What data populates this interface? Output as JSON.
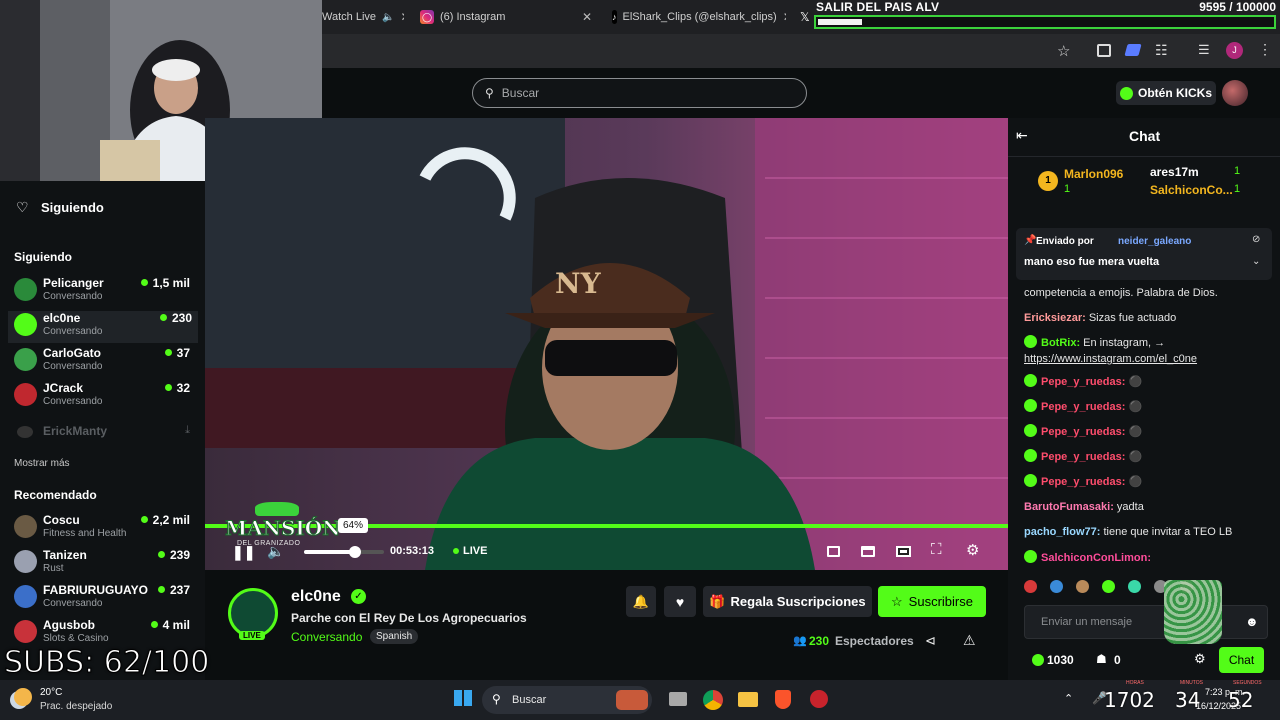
{
  "browser": {
    "tabs": [
      {
        "label": "Watch Live",
        "icon": "kick-icon"
      },
      {
        "label": "(6) Instagram",
        "icon": "instagram-icon"
      },
      {
        "label": "ElShark_Clips (@elshark_clips)",
        "icon": "tiktok-icon"
      },
      {
        "label": "",
        "icon": "x-icon"
      }
    ]
  },
  "overlay_goal": {
    "label": "SALIR DEL PAIS ALV",
    "count": "9595 / 100000",
    "progress": 0.096
  },
  "subs_overlay": "SUBS: 62/100",
  "kick": {
    "search_placeholder": "Buscar",
    "get_kicks": "Obtén KICKs"
  },
  "sidebar": {
    "following_header": "Siguiendo",
    "following_label": "Siguiendo",
    "following": [
      {
        "name": "Pelicanger",
        "sub": "Conversando",
        "viewers": "1,5 mil",
        "color": "#2a8a3a"
      },
      {
        "name": "elc0ne",
        "sub": "Conversando",
        "viewers": "230",
        "color": "#53fc18"
      },
      {
        "name": "CarloGato",
        "sub": "Conversando",
        "viewers": "37",
        "color": "#3aa04a"
      },
      {
        "name": "JCrack",
        "sub": "Conversando",
        "viewers": "32",
        "color": "#c0282f"
      }
    ],
    "offline": "ErickManty",
    "show_more": "Mostrar más",
    "recommended_label": "Recomendado",
    "recommended": [
      {
        "name": "Coscu",
        "sub": "Fitness and Health",
        "viewers": "2,2 mil",
        "color": "#6a5a44"
      },
      {
        "name": "Tanizen",
        "sub": "Rust",
        "viewers": "239",
        "color": "#9aa0b0"
      },
      {
        "name": "FABRIURUGUAYO",
        "sub": "Conversando",
        "viewers": "237",
        "color": "#3b6fc9"
      },
      {
        "name": "Agusbob",
        "sub": "Slots & Casino",
        "viewers": "4 mil",
        "color": "#c8323a"
      }
    ]
  },
  "player": {
    "volume_percent": "64%",
    "volume": 0.64,
    "time": "00:53:13",
    "live": "LIVE",
    "watermark_title": "MANSIÓN",
    "watermark_sub": "DEL GRANIZADO"
  },
  "stream": {
    "channel": "elc0ne",
    "title": "Parche con El Rey De Los Agropecuarios",
    "category": "Conversando",
    "language": "Spanish",
    "live_badge": "LIVE",
    "gift_subs": "Regala Suscripciones",
    "subscribe": "Suscribirse",
    "viewers": "230",
    "viewers_label": "Espectadores"
  },
  "chat": {
    "title": "Chat",
    "leaderboard": [
      {
        "rank": "1",
        "name": "Marlon096",
        "count": "1"
      },
      {
        "name": "ares17m",
        "count": "1"
      },
      {
        "name": "SalchiconCo...",
        "count": "1"
      }
    ],
    "pinned_by_label": "Enviado por",
    "pinned_user": "neider_galeano",
    "pinned_text": "mano eso fue mera vuelta",
    "messages": [
      {
        "user": "",
        "text": "competencia a emojis. Palabra de Dios.",
        "color": "#e6e6e6"
      },
      {
        "user": "Ericksiezar:",
        "text": "Sizas fue actuado",
        "color": "#ff9a9a"
      },
      {
        "user": "BotRix:",
        "text": "En instagram, →",
        "color": "#53fc18"
      },
      {
        "user": "",
        "text": "https://www.instagram.com/el_c0ne",
        "color": "#ffffff"
      },
      {
        "user": "Pepe_y_ruedas:",
        "text": "",
        "color": "#ff4d6d"
      },
      {
        "user": "Pepe_y_ruedas:",
        "text": "",
        "color": "#ff4d6d"
      },
      {
        "user": "Pepe_y_ruedas:",
        "text": "",
        "color": "#ff4d6d"
      },
      {
        "user": "Pepe_y_ruedas:",
        "text": "",
        "color": "#ff4d6d"
      },
      {
        "user": "Pepe_y_ruedas:",
        "text": "",
        "color": "#ff4d6d"
      },
      {
        "user": "BarutoFumasaki:",
        "text": "yadta",
        "color": "#ff7ab0"
      },
      {
        "user": "pacho_flow77:",
        "text": "tiene que invitar a TEO LB",
        "color": "#9ad8ff"
      },
      {
        "user": "SalchiconConLimon:",
        "text": "",
        "color": "#ff4d9a"
      }
    ],
    "input_placeholder": "Enviar un mensaje",
    "kicks_balance": "1030",
    "points": "0",
    "send": "Chat"
  },
  "taskbar": {
    "weather_temp": "20°C",
    "weather_desc": "Prac. despejado",
    "search": "Buscar",
    "time": "7:23 p. m.",
    "date": "16/12/2025",
    "overlay_timer": [
      "1702",
      "34",
      "52"
    ],
    "overlay_timer_labels": [
      "HORAS",
      "MINUTOS",
      "SEGUNDOS"
    ]
  }
}
